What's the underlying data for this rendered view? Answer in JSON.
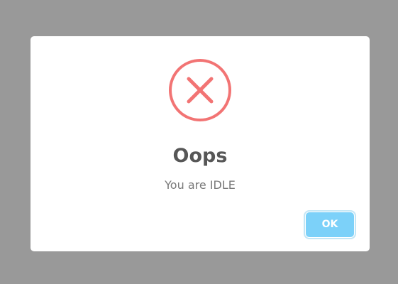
{
  "dialog": {
    "icon": "error-x-icon",
    "icon_color": "#f27474",
    "title": "Oops",
    "message": "You are IDLE",
    "ok_label": "OK",
    "button_color": "#7cd1f9",
    "overlay_color": "#999999"
  }
}
